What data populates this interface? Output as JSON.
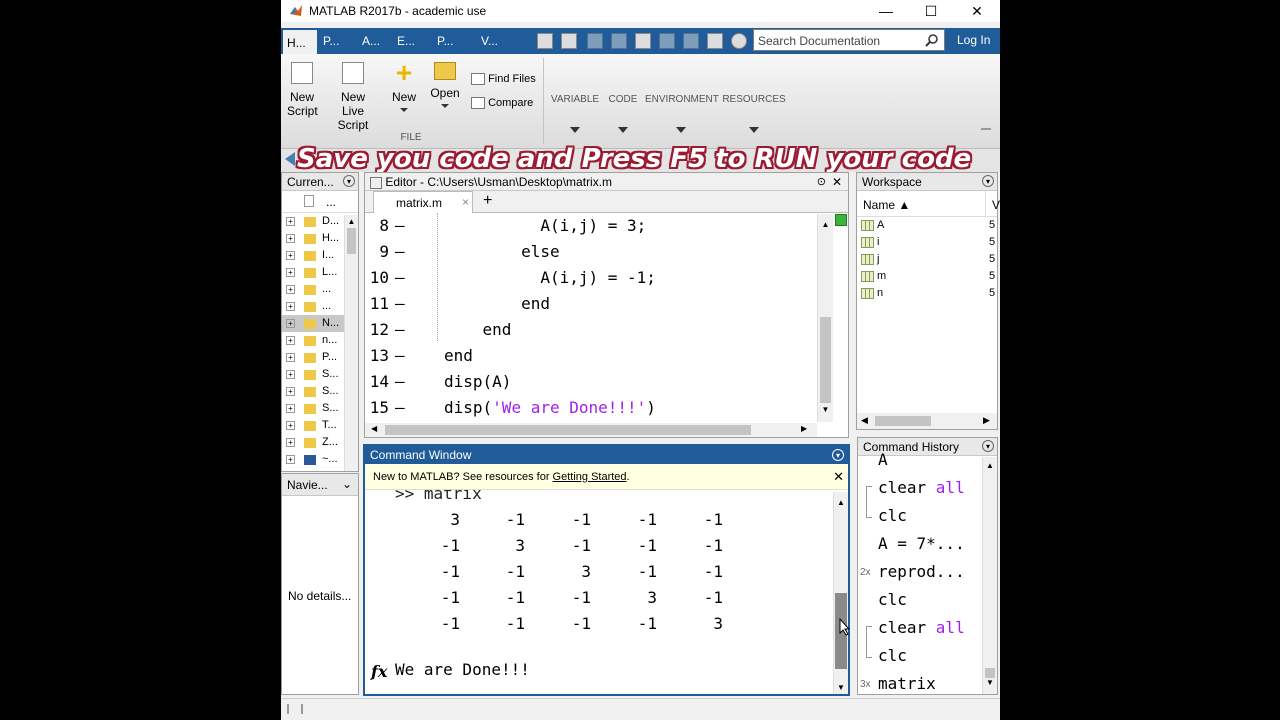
{
  "window": {
    "title": "MATLAB R2017b - academic use",
    "minimize": "—",
    "maximize": "☐",
    "close": "✕"
  },
  "tabs": [
    "H...",
    "P...",
    "A...",
    "E...",
    "P...",
    "V..."
  ],
  "search": {
    "placeholder": "Search Documentation"
  },
  "login_label": "Log In",
  "ribbon": {
    "new_script": "New\nScript",
    "new_live_script": "New\nLive Script",
    "new": "New",
    "open": "Open",
    "find_files": "Find Files",
    "compare": "Compare",
    "file_section": "FILE",
    "variable": "VARIABLE",
    "code": "CODE",
    "environment": "ENVIRONMENT",
    "resources": "RESOURCES"
  },
  "banner": "Save you code and Press F5 to RUN your code",
  "current_folder": {
    "title": "Curren...",
    "header": "...",
    "items": [
      "D...",
      "H...",
      "I...",
      "L...",
      "...",
      "...",
      "N...",
      "n...",
      "P...",
      "S...",
      "S...",
      "S...",
      "T...",
      "Z...",
      "~..."
    ]
  },
  "navigator": {
    "title": "Navie...",
    "empty": "No details..."
  },
  "editor": {
    "path": "Editor - C:\\Users\\Usman\\Desktop\\matrix.m",
    "tab": "matrix.m",
    "add_tab": "+",
    "lines": [
      {
        "n": "8",
        "indent": "          ",
        "text": "A(i,j) = 3;"
      },
      {
        "n": "9",
        "indent": "        ",
        "text": "else"
      },
      {
        "n": "10",
        "indent": "          ",
        "text": "A(i,j) = -1;"
      },
      {
        "n": "11",
        "indent": "        ",
        "text": "end"
      },
      {
        "n": "12",
        "indent": "    ",
        "text": "end"
      },
      {
        "n": "13",
        "indent": "",
        "text": "end"
      },
      {
        "n": "14",
        "indent": "",
        "text": "disp(A)"
      },
      {
        "n": "15",
        "indent": "",
        "text": "disp(",
        "str": "'We are Done!!!'",
        "after": ")"
      }
    ]
  },
  "workspace": {
    "title": "Workspace",
    "col_name": "Name ▲",
    "col_value": "V",
    "vars": [
      {
        "name": "A",
        "value": "5"
      },
      {
        "name": "i",
        "value": "5"
      },
      {
        "name": "j",
        "value": "5"
      },
      {
        "name": "m",
        "value": "5"
      },
      {
        "name": "n",
        "value": "5"
      }
    ]
  },
  "command_window": {
    "title": "Command Window",
    "notice": "New to MATLAB? See resources for",
    "notice_link": "Getting Started",
    "notice_end": ".",
    "prompt": ">> matrix",
    "matrix": [
      [
        "3",
        "-1",
        "-1",
        "-1",
        "-1"
      ],
      [
        "-1",
        "3",
        "-1",
        "-1",
        "-1"
      ],
      [
        "-1",
        "-1",
        "3",
        "-1",
        "-1"
      ],
      [
        "-1",
        "-1",
        "-1",
        "3",
        "-1"
      ],
      [
        "-1",
        "-1",
        "-1",
        "-1",
        "3"
      ]
    ],
    "output": "We are Done!!!",
    "fx": "fx"
  },
  "command_history": {
    "title": "Command History",
    "items": [
      {
        "prefix": "",
        "text": "A",
        "kw": ""
      },
      {
        "prefix": "",
        "text": "clear ",
        "kw": "all"
      },
      {
        "prefix": "",
        "text": "clc",
        "kw": ""
      },
      {
        "prefix": "",
        "text": "A = 7*...",
        "kw": ""
      },
      {
        "prefix": "2x",
        "text": "reprod...",
        "kw": ""
      },
      {
        "prefix": "",
        "text": "clc",
        "kw": ""
      },
      {
        "prefix": "",
        "text": "clear ",
        "kw": "all"
      },
      {
        "prefix": "",
        "text": "clc",
        "kw": ""
      },
      {
        "prefix": "3x",
        "text": "matrix",
        "kw": ""
      }
    ]
  },
  "colors": {
    "accent": "#1f5c99",
    "banner_outline": "#9b1b30",
    "string": "#a020f0",
    "keyword": "#0000ff"
  }
}
